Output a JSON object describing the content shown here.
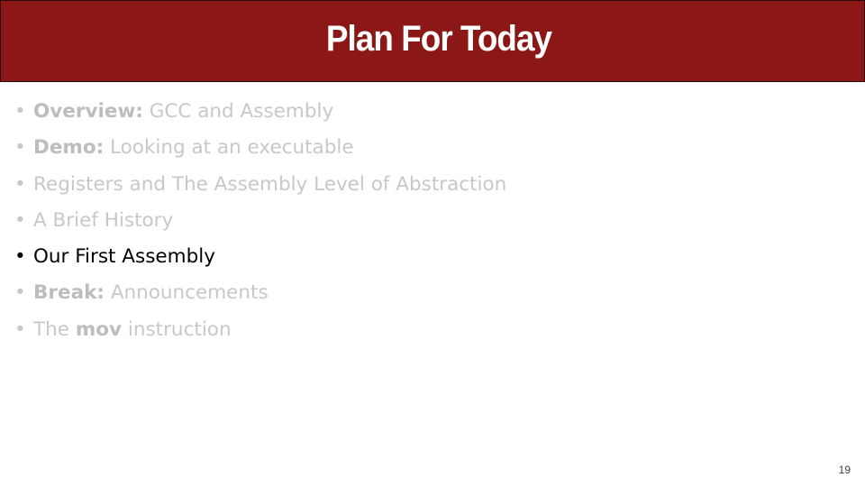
{
  "slide": {
    "title": "Plan For Today",
    "page_number": "19",
    "colors": {
      "title_bar": "#8b1717",
      "title_text": "#ffffff",
      "active_text": "#000000",
      "inactive_text": "#c8c8c8"
    },
    "bullets": [
      {
        "bold": "Overview:",
        "text": " GCC and Assembly",
        "active": false
      },
      {
        "bold": "Demo:",
        "text": " Looking at an executable",
        "active": false
      },
      {
        "bold": "",
        "text": "Registers and The Assembly Level of Abstraction",
        "active": false
      },
      {
        "bold": "",
        "text": "A Brief History",
        "active": false
      },
      {
        "bold": "",
        "text": "Our First Assembly",
        "active": true
      },
      {
        "bold": "Break:",
        "text": " Announcements",
        "active": false
      },
      {
        "pre": "The ",
        "bold": "mov",
        "text": " instruction",
        "active": false
      }
    ],
    "bullet_glyph": "•"
  }
}
